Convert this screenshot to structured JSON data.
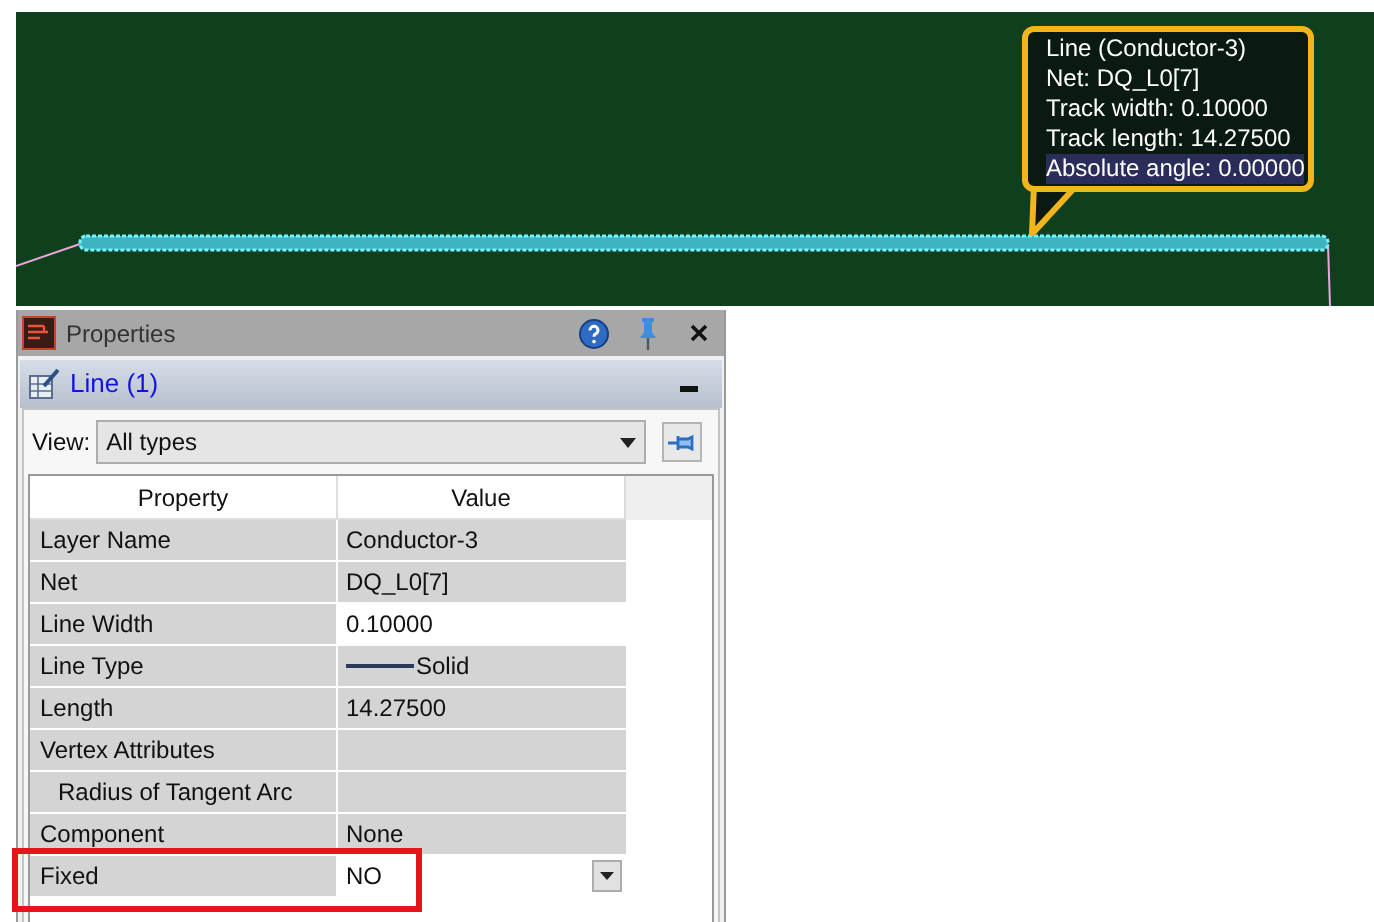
{
  "canvas": {
    "tooltip": [
      {
        "text": "Line (Conductor-3)",
        "highlighted": false
      },
      {
        "text": "Net: DQ_L0[7]",
        "highlighted": false
      },
      {
        "text": "Track width: 0.10000",
        "highlighted": false
      },
      {
        "text": "Track length: 14.27500",
        "highlighted": false
      },
      {
        "text": "Absolute angle: 0.00000",
        "highlighted": true
      }
    ]
  },
  "panel": {
    "title": "Properties",
    "section": {
      "title": "Line (1)",
      "expanded": true
    },
    "view": {
      "label": "View:",
      "value": "All types"
    },
    "table": {
      "columns": [
        "Property",
        "Value"
      ],
      "rows": [
        {
          "property": "Layer Name",
          "value": "Conductor-3",
          "kind": "plain"
        },
        {
          "property": "Net",
          "value": "DQ_L0[7]",
          "kind": "plain"
        },
        {
          "property": "Line Width",
          "value": "0.10000",
          "kind": "edit"
        },
        {
          "property": "Line Type",
          "value": "Solid",
          "kind": "linetype"
        },
        {
          "property": "Length",
          "value": "14.27500",
          "kind": "plain"
        },
        {
          "property": "Vertex Attributes",
          "kind": "plain",
          "children": [
            {
              "property": "Radius of Tangent Arc"
            }
          ]
        },
        {
          "property": "Component",
          "value": "None",
          "kind": "plain"
        },
        {
          "property": "Fixed",
          "value": "NO",
          "kind": "dropdown",
          "highlighted": true
        }
      ]
    }
  }
}
